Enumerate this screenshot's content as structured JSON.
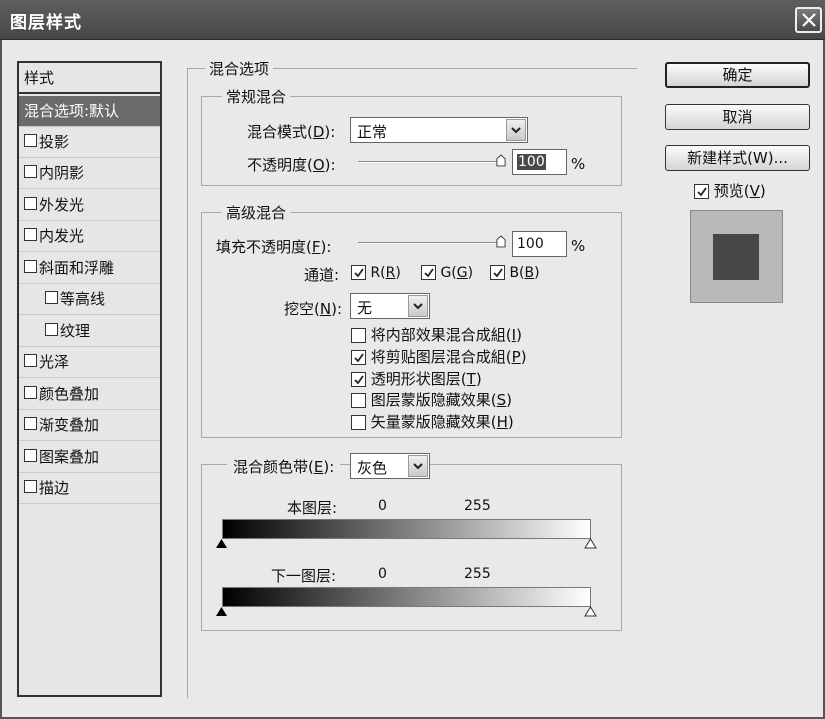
{
  "window": {
    "title": "图层样式",
    "close_icon": "close-icon"
  },
  "style_list": {
    "header": "样式",
    "items": [
      {
        "label": "混合选项:默认",
        "selected": true,
        "checkbox": false,
        "indent": false
      },
      {
        "label": "投影",
        "checkbox": true,
        "indent": false
      },
      {
        "label": "内阴影",
        "checkbox": true,
        "indent": false
      },
      {
        "label": "外发光",
        "checkbox": true,
        "indent": false
      },
      {
        "label": "内发光",
        "checkbox": true,
        "indent": false
      },
      {
        "label": "斜面和浮雕",
        "checkbox": true,
        "indent": false
      },
      {
        "label": "等高线",
        "checkbox": true,
        "indent": true
      },
      {
        "label": "纹理",
        "checkbox": true,
        "indent": true
      },
      {
        "label": "光泽",
        "checkbox": true,
        "indent": false
      },
      {
        "label": "颜色叠加",
        "checkbox": true,
        "indent": false
      },
      {
        "label": "渐变叠加",
        "checkbox": true,
        "indent": false
      },
      {
        "label": "图案叠加",
        "checkbox": true,
        "indent": false
      },
      {
        "label": "描边",
        "checkbox": true,
        "indent": false
      }
    ]
  },
  "blend_options": {
    "title": "混合选项",
    "general": {
      "title": "常规混合",
      "mode_label": "混合模式(",
      "mode_key": "D",
      "mode_close": "):",
      "mode_value": "正常",
      "opacity_label": "不透明度(",
      "opacity_key": "O",
      "opacity_close": "):",
      "opacity_value": "100",
      "opacity_unit": "%",
      "opacity_fraction": 1.0
    },
    "advanced": {
      "title": "高级混合",
      "fill_label": "填充不透明度(",
      "fill_key": "F",
      "fill_close": "):",
      "fill_value": "100",
      "fill_unit": "%",
      "fill_fraction": 1.0,
      "channels_label": "通道:",
      "channels": [
        {
          "label": "R(",
          "key": "R",
          "close": ")",
          "checked": true
        },
        {
          "label": "G(",
          "key": "G",
          "close": ")",
          "checked": true
        },
        {
          "label": "B(",
          "key": "B",
          "close": ")",
          "checked": true
        }
      ],
      "knockout_label": "挖空(",
      "knockout_key": "N",
      "knockout_close": "):",
      "knockout_value": "无",
      "options": [
        {
          "label": "将内部效果混合成組(",
          "key": "I",
          "close": ")",
          "checked": false
        },
        {
          "label": "将剪贴图层混合成組(",
          "key": "P",
          "close": ")",
          "checked": true
        },
        {
          "label": "透明形状图层(",
          "key": "T",
          "close": ")",
          "checked": true
        },
        {
          "label": "图层蒙版隐藏效果(",
          "key": "S",
          "close": ")",
          "checked": false
        },
        {
          "label": "矢量蒙版隐藏效果(",
          "key": "H",
          "close": ")",
          "checked": false
        }
      ]
    },
    "blend_if": {
      "label": "混合颜色带(",
      "key": "E",
      "close": "):",
      "value": "灰色",
      "this_layer_label": "本图层:",
      "this_layer_low": "0",
      "this_layer_high": "255",
      "underlying_label": "下一图层:",
      "underlying_low": "0",
      "underlying_high": "255"
    }
  },
  "buttons": {
    "ok": "确定",
    "cancel": "取消",
    "new_style": "新建样式(W)...",
    "preview_label": "预览(",
    "preview_key": "V",
    "preview_close": ")",
    "preview_checked": true
  },
  "colors": {
    "title_bar": "#4f4f4f",
    "selected_item": "#6a6a6a",
    "preview_bg": "#b9b9b9",
    "preview_swatch": "#474747"
  }
}
